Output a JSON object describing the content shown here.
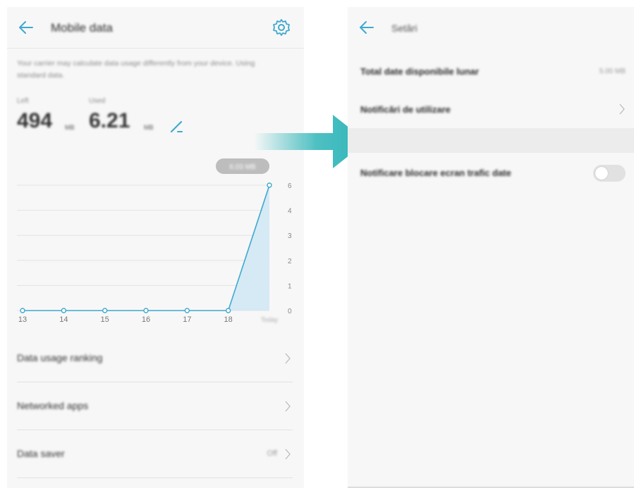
{
  "colors": {
    "accent": "#3fa9cf",
    "arrow": "#2fb5b8",
    "panel_bg": "#f7f7f7"
  },
  "left_screen": {
    "header": {
      "title": "Mobile data",
      "back_icon": "arrow-left",
      "settings_icon": "gear"
    },
    "note": "Your carrier may calculate data usage differently from your device. Using standard data.",
    "stats": {
      "left": {
        "label": "Left",
        "value": "494",
        "unit": "MB"
      },
      "used": {
        "label": "Used",
        "value": "6.21",
        "unit": "MB"
      }
    },
    "chart": {
      "tooltip": "6.03 MB",
      "y_ticks": [
        "6",
        "4",
        "3",
        "2",
        "1",
        "0"
      ],
      "x_ticks": [
        "13",
        "14",
        "15",
        "16",
        "17",
        "18",
        "Today"
      ]
    },
    "list": [
      {
        "label": "Data usage ranking",
        "value": ""
      },
      {
        "label": "Networked apps",
        "value": ""
      },
      {
        "label": "Data saver",
        "value": "Off"
      }
    ]
  },
  "right_screen": {
    "header": {
      "title": "Setări",
      "back_icon": "arrow-left"
    },
    "rows": {
      "total": {
        "label": "Total date disponibile lunar",
        "value": "5.00 MB"
      },
      "notifications": {
        "label": "Notificări de utilizare"
      },
      "lock_screen": {
        "label": "Notificare blocare ecran trafic date",
        "toggle": "off"
      }
    }
  },
  "chart_data": {
    "type": "line",
    "x": [
      "13",
      "14",
      "15",
      "16",
      "17",
      "18",
      "Today"
    ],
    "values": [
      0,
      0,
      0,
      0,
      0,
      0,
      6
    ],
    "ylim": [
      0,
      6
    ],
    "yticks": [
      6,
      4,
      3,
      2,
      1,
      0
    ],
    "annotation": "6.03 MB",
    "grid": true
  }
}
